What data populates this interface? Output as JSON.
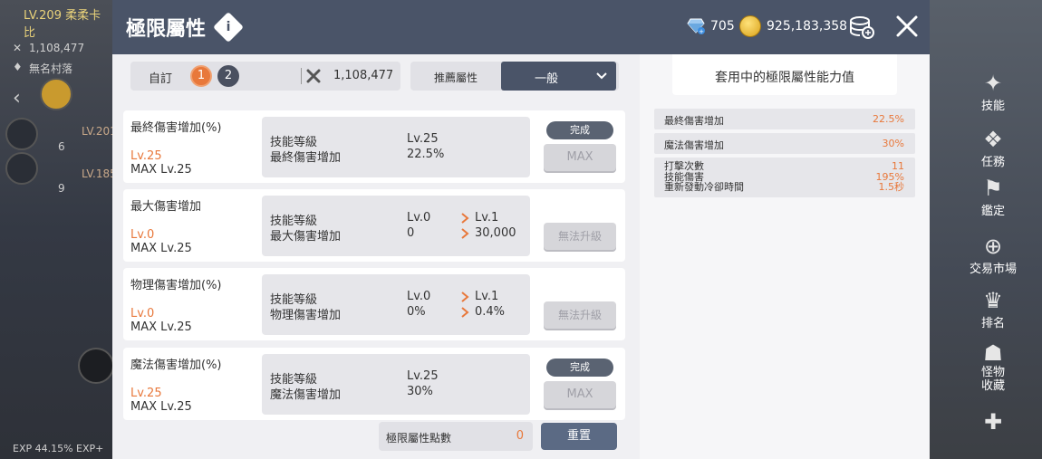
{
  "hud": {
    "level_name": "LV.209 柔柔卡比",
    "power": "1,108,477",
    "guild": "無名村落",
    "left_row1": "LV.201",
    "left_row1_num": "6",
    "left_row2": "LV.185",
    "left_row2_num": "9",
    "exp": "EXP 44.15%",
    "exp2": "EXP+"
  },
  "side_menu": [
    {
      "label": "技能",
      "icon": "skill-icon"
    },
    {
      "label": "任務",
      "icon": "quest-icon"
    },
    {
      "label": "鑑定",
      "icon": "appraise-icon"
    },
    {
      "label": "交易市場",
      "icon": "market-icon"
    },
    {
      "label": "排名",
      "icon": "rank-icon"
    },
    {
      "label": "怪物收藏",
      "icon": "monster-icon"
    }
  ],
  "header": {
    "title": "極限屬性",
    "gems": "705",
    "gold": "925,183,358"
  },
  "preset": {
    "label": "自訂",
    "tab1": "1",
    "tab2": "2",
    "power": "1,108,477"
  },
  "recommend": {
    "label": "推薦屬性",
    "selected": "一般"
  },
  "cards": [
    {
      "name": "最終傷害增加(%)",
      "lv": "Lv.25",
      "max": "MAX Lv.25",
      "row1_label": "技能等級",
      "row2_label": "最終傷害增加",
      "cur_lv": "Lv.25",
      "cur_val": "22.5%",
      "next_lv": "",
      "next_val": "",
      "done": "完成",
      "button": "MAX"
    },
    {
      "name": "最大傷害增加",
      "lv": "Lv.0",
      "max": "MAX Lv.25",
      "row1_label": "技能等級",
      "row2_label": "最大傷害增加",
      "cur_lv": "Lv.0",
      "cur_val": "0",
      "next_lv": "Lv.1",
      "next_val": "30,000",
      "done": "",
      "button": "無法升級"
    },
    {
      "name": "物理傷害增加(%)",
      "lv": "Lv.0",
      "max": "MAX Lv.25",
      "row1_label": "技能等級",
      "row2_label": "物理傷害增加",
      "cur_lv": "Lv.0",
      "cur_val": "0%",
      "next_lv": "Lv.1",
      "next_val": "0.4%",
      "done": "",
      "button": "無法升級"
    },
    {
      "name": "魔法傷害增加(%)",
      "lv": "Lv.25",
      "max": "MAX Lv.25",
      "row1_label": "技能等級",
      "row2_label": "魔法傷害增加",
      "cur_lv": "Lv.25",
      "cur_val": "30%",
      "next_lv": "",
      "next_val": "",
      "done": "完成",
      "button": "MAX"
    }
  ],
  "points": {
    "label": "極限屬性點數",
    "value": "0"
  },
  "reset_label": "重置",
  "summary": {
    "title": "套用中的極限屬性能力值",
    "stats": [
      {
        "name": "最終傷害增加",
        "value": "22.5%"
      },
      {
        "name": "魔法傷害增加",
        "value": "30%"
      }
    ],
    "multi": [
      {
        "name": "打擊次數",
        "value": "11"
      },
      {
        "name": "技能傷害",
        "value": "195%"
      },
      {
        "name": "重新發動冷卻時間",
        "value": "1.5秒"
      }
    ]
  },
  "colors": {
    "accent": "#e8783b",
    "header": "#4a5468",
    "button_dark": "#5b6a84"
  }
}
